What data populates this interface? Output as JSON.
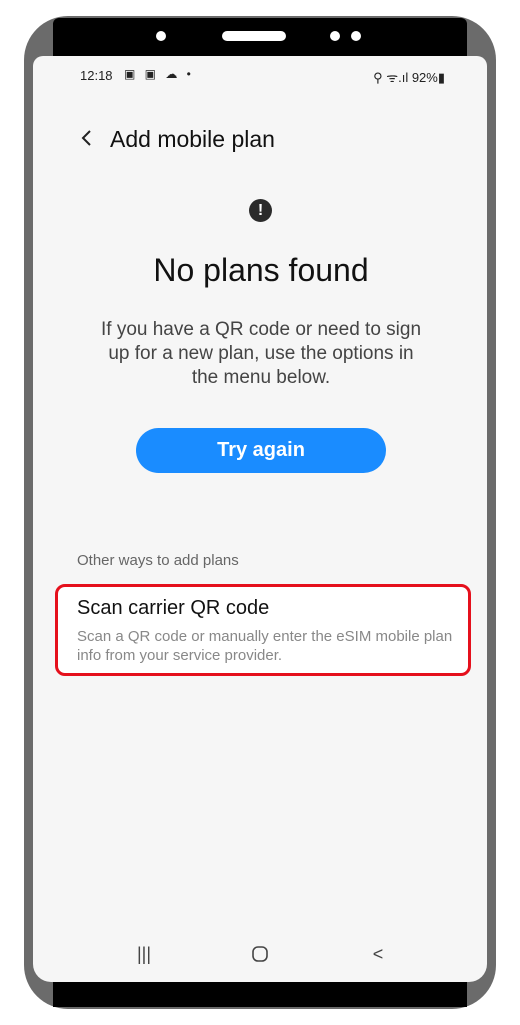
{
  "status_bar": {
    "time": "12:18",
    "notification_icons": "▣ ▣ ☁ •",
    "right": "⚲ ᯤ.ıl 92%▮"
  },
  "header": {
    "title": "Add mobile plan"
  },
  "main": {
    "heading": "No plans found",
    "description": "If you have a QR code or need to sign up for a new plan, use the options in the menu below.",
    "try_again": "Try again",
    "section_label": "Other ways to add plans",
    "scan_option": {
      "title": "Scan carrier QR code",
      "subtitle": "Scan a QR code or manually enter the eSIM mobile plan info from your service provider."
    }
  },
  "nav_bar": {
    "recents": "|||",
    "home": "○",
    "back": "<"
  },
  "colors": {
    "accent": "#1a8cff",
    "highlight": "#e5101c"
  }
}
